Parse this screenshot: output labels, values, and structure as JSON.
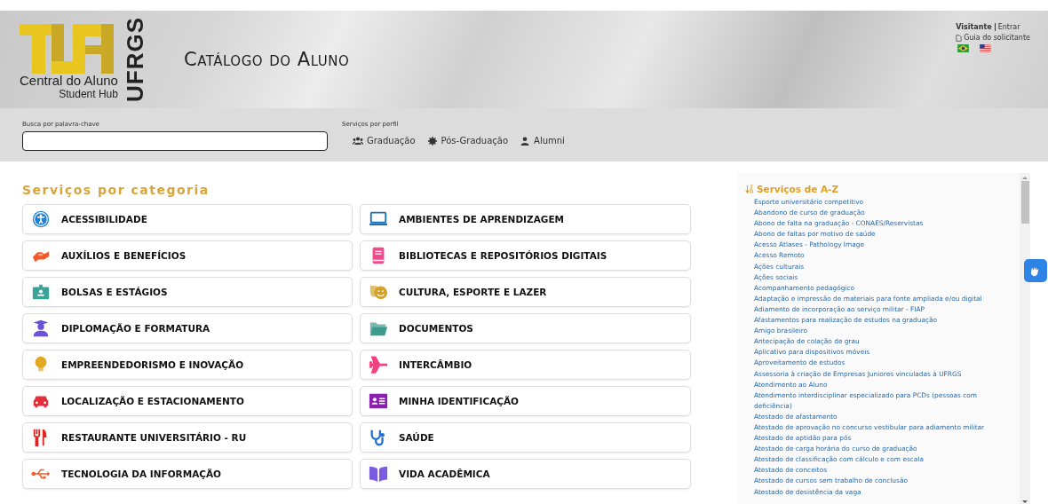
{
  "header": {
    "logo_line1": "Central do Aluno",
    "logo_line2": "Student Hub",
    "logo_vertical": "UFRGS",
    "title": "Catálogo do Aluno",
    "user": "Visitante",
    "login": "Entrar",
    "guide": "Guia do solicitante"
  },
  "search": {
    "label": "Busca por palavra-chave"
  },
  "profiles": {
    "label": "Serviços por perfil",
    "items": [
      "Graduação",
      "Pós-Graduação",
      "Alumni"
    ]
  },
  "categories": {
    "title": "Serviços por categoria",
    "items": [
      {
        "label": "ACESSIBILIDADE",
        "color": "#1e7fd8"
      },
      {
        "label": "AMBIENTES DE APRENDIZAGEM",
        "color": "#1b6fb5"
      },
      {
        "label": "AUXÍLIOS E BENEFÍCIOS",
        "color": "#ef5b2b"
      },
      {
        "label": "BIBLIOTECAS E REPOSITÓRIOS DIGITAIS",
        "color": "#ee4b8b"
      },
      {
        "label": "BOLSAS E ESTÁGIOS",
        "color": "#3aa39a"
      },
      {
        "label": "CULTURA, ESPORTE E LAZER",
        "color": "#d4a22a"
      },
      {
        "label": "DIPLOMAÇÃO E FORMATURA",
        "color": "#6b52d6"
      },
      {
        "label": "DOCUMENTOS",
        "color": "#3d9a8e"
      },
      {
        "label": "EMPREENDEDORISMO E INOVAÇÃO",
        "color": "#e2a823"
      },
      {
        "label": "INTERCÂMBIO",
        "color": "#f0407f"
      },
      {
        "label": "LOCALIZAÇÃO E ESTACIONAMENTO",
        "color": "#e52e3a"
      },
      {
        "label": "MINHA IDENTIFICAÇÃO",
        "color": "#8a1fb0"
      },
      {
        "label": "RESTAURANTE UNIVERSITÁRIO - RU",
        "color": "#e02424"
      },
      {
        "label": "SAÚDE",
        "color": "#1d6fd0"
      },
      {
        "label": "TECNOLOGIA DA INFORMAÇÃO",
        "color": "#ef5b2b"
      },
      {
        "label": "VIDA ACADÊMICA",
        "color": "#7b5ce0"
      }
    ]
  },
  "az": {
    "title": "Serviços de A-Z",
    "items": [
      "Esporte universitário competitivo",
      "Abandono de curso de graduação",
      "Abono de falta na graduação - CONAES/Reservistas",
      "Abono de faltas por motivo de saúde",
      "Acesso Atlases - Pathology Image",
      "Acesso Remoto",
      "Ações culturais",
      "Ações sociais",
      "Acompanhamento pedagógico",
      "Adaptação e impressão de materiais para fonte ampliada e/ou digital",
      "Adiamento de incorporação ao serviço militar - FIAP",
      "Afastamentos para realização de estudos na graduação",
      "Amigo brasileiro",
      "Antecipação de colação de grau",
      "Aplicativo para dispositivos móveis",
      "Aproveitamento de estudos",
      "Assessoria à criação de Empresas Juniores vinculadas à UFRGS",
      "Atendimento ao Aluno",
      "Atendimento interdisciplinar especializado para PCDs (pessoas com deficiência)",
      "Atestado de afastamento",
      "Atestado de aprovação no concurso vestibular para adiamento militar",
      "Atestado de aptidão para pós",
      "Atestado de carga horária do curso de graduação",
      "Atestado de classificação com cálculo e com escala",
      "Atestado de conceitos",
      "Atestado de cursos sem trabalho de conclusão",
      "Atestado de desistência da vaga"
    ]
  }
}
